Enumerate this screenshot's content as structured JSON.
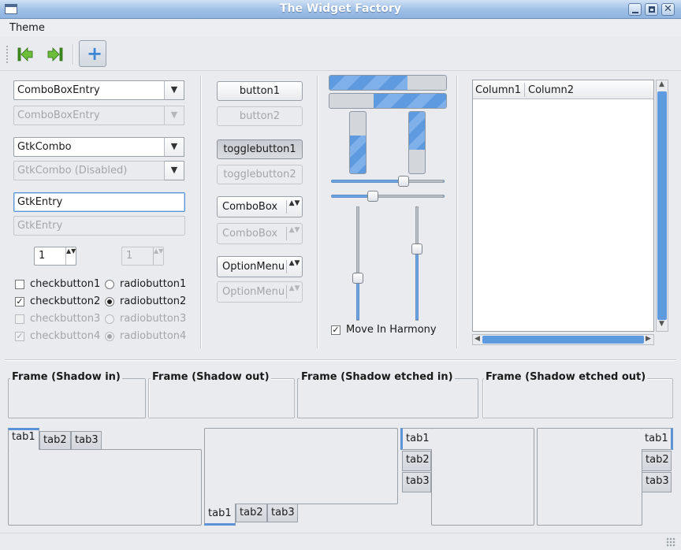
{
  "window": {
    "title": "The Widget Factory"
  },
  "menu": {
    "theme": "Theme"
  },
  "col1": {
    "combo_entry": "ComboBoxEntry",
    "combo_entry_dis": "ComboBoxEntry",
    "gtk_combo": "GtkCombo",
    "gtk_combo_dis": "GtkCombo (Disabled)",
    "gtk_entry": "GtkEntry",
    "gtk_entry_dis": "GtkEntry",
    "spin1": "1",
    "spin2": "1",
    "checks": [
      "checkbutton1",
      "checkbutton2",
      "checkbutton3",
      "checkbutton4"
    ],
    "radios": [
      "radiobutton1",
      "radiobutton2",
      "radiobutton3",
      "radiobutton4"
    ],
    "check_marks": [
      "",
      "✓",
      "",
      "✓"
    ]
  },
  "col2": {
    "button1": "button1",
    "button2": "button2",
    "toggle1": "togglebutton1",
    "toggle2": "togglebutton2",
    "combobox": "ComboBox",
    "combobox_dis": "ComboBox",
    "option": "OptionMenu",
    "option_dis": "OptionMenu"
  },
  "col3": {
    "progress_h1": 0.67,
    "progress_h2_start": 0.38,
    "progress_v1_start": 0.38,
    "progress_v2": 0.62,
    "hslider1": 0.64,
    "hslider2": 0.37,
    "vslider1": 0.63,
    "vslider2": 0.37,
    "harmony_mark": "✓",
    "harmony": "Move In Harmony"
  },
  "tree": {
    "column1": "Column1",
    "column2": "Column2"
  },
  "frames": [
    "Frame (Shadow in)",
    "Frame (Shadow out)",
    "Frame (Shadow etched in)",
    "Frame (Shadow etched out)"
  ],
  "tabs": [
    "tab1",
    "tab2",
    "tab3"
  ],
  "glyphs": {
    "down": "▼",
    "updown": "▲▼",
    "left": "◀",
    "right": "▶",
    "up": "▲"
  }
}
